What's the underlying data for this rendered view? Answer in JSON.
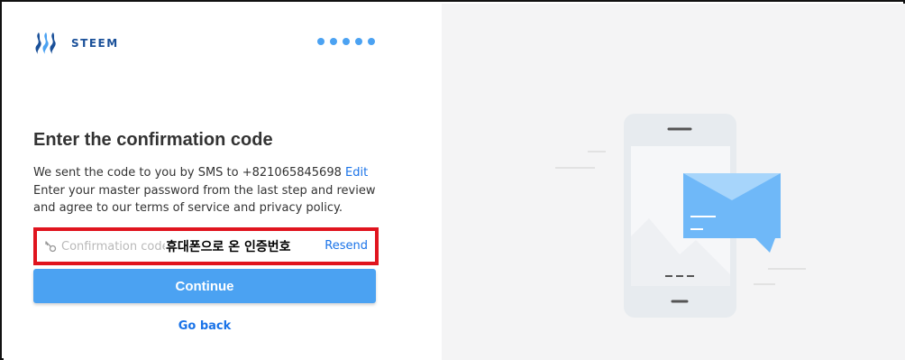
{
  "brand": {
    "name": "STEEM",
    "logo_icon": "steem-logo-icon",
    "color": "#1a5099"
  },
  "progress": {
    "steps_total": 5,
    "dot_color": "#4ba2f2"
  },
  "main": {
    "title": "Enter the confirmation code",
    "sms_text": "We sent the code to you by SMS to +821065845698 ",
    "edit_label": "Edit",
    "instructions": "Enter your master password from the last step and review and agree to our terms of service and privacy policy.",
    "code_field": {
      "placeholder": "Confirmation code",
      "value": "",
      "annotation": "휴대폰으로 온 인증번호",
      "icon": "key-icon",
      "resend_label": "Resend"
    },
    "continue_label": "Continue",
    "go_back_label": "Go back"
  },
  "colors": {
    "accent": "#4ba2f2",
    "link": "#1a73e8",
    "highlight_border": "#e0141e",
    "panel_bg": "#f4f4f5"
  },
  "illustration": {
    "icon": "phone-sms-illustration",
    "code_mask": "— — —"
  }
}
